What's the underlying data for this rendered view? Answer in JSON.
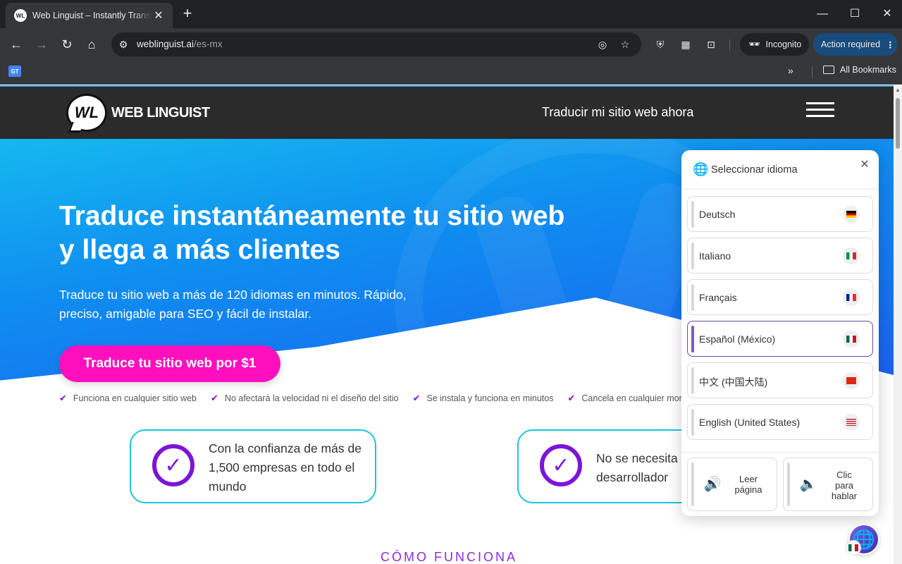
{
  "browser": {
    "tab_title": "Web Linguist – Instantly Translate",
    "tab_favicon_text": "WL",
    "url_domain": "weblinguist.ai",
    "url_path": "/es-mx",
    "incognito_label": "Incognito",
    "action_required_label": "Action required",
    "bookmark_favicon_text": "GT",
    "all_bookmarks_label": "All Bookmarks"
  },
  "site": {
    "logo_mark": "WL",
    "logo_text": "WEB LINGUIST",
    "header_cta": "Traducir mi sitio web ahora"
  },
  "hero": {
    "title_line1": "Traduce instantáneamente tu sitio web",
    "title_line2": "y llega a más clientes",
    "subtitle": "Traduce tu sitio web a más de 120 idiomas en minutos. Rápido, preciso, amigable para SEO y fácil de instalar.",
    "cta": "Traduce tu sitio web por $1",
    "checks": [
      "Funciona en cualquier sitio web",
      "No afectará la velocidad ni el diseño del sitio",
      "Se instala y funciona en minutos",
      "Cancela en cualquier momento"
    ]
  },
  "cards": [
    {
      "text_line1": "Con la confianza de más de",
      "text_line2": "1,500 empresas en todo el",
      "text_line3": "mundo"
    },
    {
      "text_line1": "No se necesita un",
      "text_line2": "desarrollador",
      "text_line3": ""
    }
  ],
  "how_it_works": "CÓMO FUNCIONA",
  "widget": {
    "title": "Seleccionar idioma",
    "languages": [
      {
        "name": "Deutsch",
        "flag": "de",
        "active": false
      },
      {
        "name": "Italiano",
        "flag": "it",
        "active": false
      },
      {
        "name": "Français",
        "flag": "fr",
        "active": false
      },
      {
        "name": "Español (México)",
        "flag": "mx",
        "active": true
      },
      {
        "name": "中文 (中国大陆)",
        "flag": "cn",
        "active": false
      },
      {
        "name": "English (United States)",
        "flag": "us",
        "active": false
      }
    ],
    "read_page_line1": "Leer",
    "read_page_line2": "página",
    "click_speak_line1": "Clic",
    "click_speak_line2": "para",
    "click_speak_line3": "hablar"
  },
  "colors": {
    "accent_magenta": "#ff0fbd",
    "accent_purple": "#7b16d8",
    "card_border": "#1cc3e0",
    "action_required_bg": "#194b7d"
  }
}
